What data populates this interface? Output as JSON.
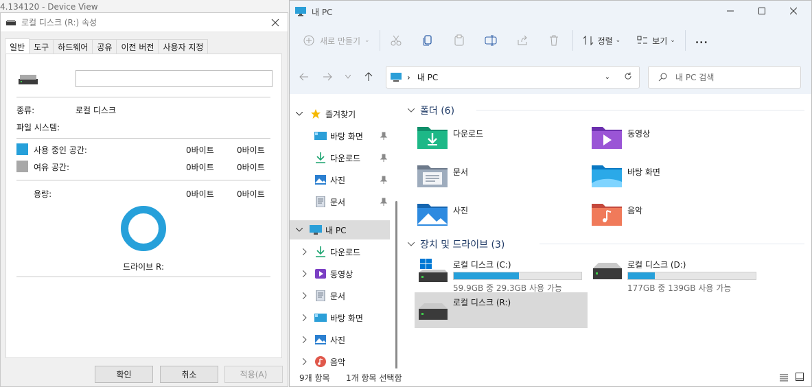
{
  "background_window": {
    "title": "4.134120 - Device View"
  },
  "properties": {
    "title": "로컬 디스크 (R:) 속성",
    "tabs": [
      "일반",
      "도구",
      "하드웨어",
      "공유",
      "이전 버전",
      "사용자 지정"
    ],
    "active_tab": "일반",
    "name_value": "",
    "type_label": "종류:",
    "type_value": "로컬 디스크",
    "fs_label": "파일 시스템:",
    "fs_value": "",
    "used_label": "사용 중인 공간:",
    "used_bytes": "0바이트",
    "used_size": "0바이트",
    "free_label": "여유 공간:",
    "free_bytes": "0바이트",
    "free_size": "0바이트",
    "capacity_label": "용량:",
    "capacity_bytes": "0바이트",
    "capacity_size": "0바이트",
    "drive_label": "드라이브 R:",
    "used_color": "#26a0da",
    "free_color": "#a8a8a8",
    "buttons": {
      "ok": "확인",
      "cancel": "취소",
      "apply": "적용(A)"
    }
  },
  "explorer": {
    "title": "내 PC",
    "toolbar": {
      "new": "새로 만들기",
      "sort": "정렬",
      "view": "보기",
      "more": "..."
    },
    "address": {
      "path": "내 PC"
    },
    "search": {
      "placeholder": "내 PC 검색"
    },
    "nav": {
      "quick_access": "즐겨찾기",
      "quick_items": [
        "바탕 화면",
        "다운로드",
        "사진",
        "문서"
      ],
      "this_pc": "내 PC",
      "pc_items": [
        "다운로드",
        "동영상",
        "문서",
        "바탕 화면",
        "사진",
        "음악"
      ]
    },
    "folders_header": "폴더 (6)",
    "folders": [
      "다운로드",
      "동영상",
      "문서",
      "바탕 화면",
      "사진",
      "음악"
    ],
    "drives_header": "장치 및 드라이브 (3)",
    "drives": [
      {
        "name": "로컬 디스크 (C:)",
        "free": "59.9GB 중 29.3GB 사용 가능",
        "used_fraction": 0.51
      },
      {
        "name": "로컬 디스크 (D:)",
        "free": "177GB 중 139GB 사용 가능",
        "used_fraction": 0.21
      },
      {
        "name": "로컬 디스크 (R:)",
        "free": "",
        "used_fraction": 0
      }
    ],
    "status": {
      "count": "9개 항목",
      "selected": "1개 항목 선택함"
    }
  }
}
